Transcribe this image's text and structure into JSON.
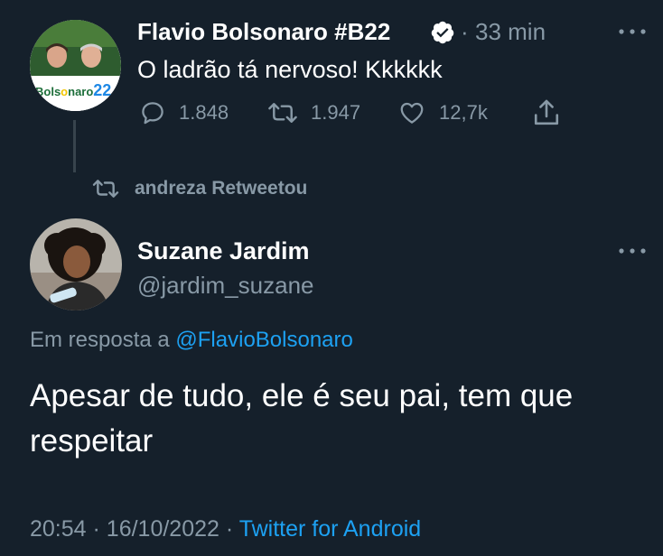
{
  "first_tweet": {
    "author_name": "Flavio Bolsonaro #B22",
    "time_ago": "33 min",
    "separator": "·",
    "text": "O ladrão tá nervoso! Kkkkkk",
    "avatar_badge": "Bolsonaro 22",
    "avatar_badge_parts": [
      "Bols",
      "naro",
      "22"
    ],
    "stats": {
      "replies": "1.848",
      "retweets": "1.947",
      "likes": "12,7k"
    }
  },
  "retweet_notice": "andreza Retweetou",
  "second_tweet": {
    "author_name": "Suzane Jardim",
    "handle": "@jardim_suzane",
    "reply_prefix": "Em resposta a",
    "reply_to": "@FlavioBolsonaro",
    "text": "Apesar de tudo, ele é seu pai, tem que respeitar",
    "time": "20:54",
    "date": "16/10/2022",
    "source": "Twitter for Android",
    "separator": "·"
  },
  "colors": {
    "background": "#15202b",
    "primary_text": "#ffffff",
    "secondary_text": "#8899a6",
    "link": "#1da1f2",
    "thread_line": "#38444d"
  },
  "icons": [
    "verified-badge-icon",
    "more-options-icon",
    "reply-icon",
    "retweet-icon",
    "like-icon",
    "share-icon"
  ]
}
